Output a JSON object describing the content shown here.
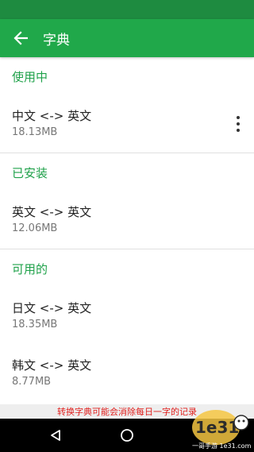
{
  "app_bar": {
    "title": "字典",
    "back_icon": "arrow-left-icon"
  },
  "sections": {
    "in_use": {
      "header": "使用中",
      "items": [
        {
          "title": "中文 <-> 英文",
          "size": "18.13MB"
        }
      ],
      "more_icon": "more-vert-icon"
    },
    "installed": {
      "header": "已安装",
      "items": [
        {
          "title": "英文 <-> 英文",
          "size": "12.06MB"
        }
      ]
    },
    "available": {
      "header": "可用的",
      "items": [
        {
          "title": "日文 <-> 英文",
          "size": "18.35MB"
        },
        {
          "title": "韩文 <-> 英文",
          "size": "8.77MB"
        }
      ]
    }
  },
  "toast": {
    "text": "转换字典可能会消除每日一字的记录"
  },
  "nav": {
    "back_icon": "triangle-back-icon",
    "home_icon": "circle-home-icon"
  },
  "watermark": {
    "text": "1e31 一哥手游 1e31.com"
  },
  "colors": {
    "primary": "#20a84a",
    "status_bar": "#1e8b40",
    "section_header": "#1fa14a",
    "toast_text": "#e0201e"
  }
}
